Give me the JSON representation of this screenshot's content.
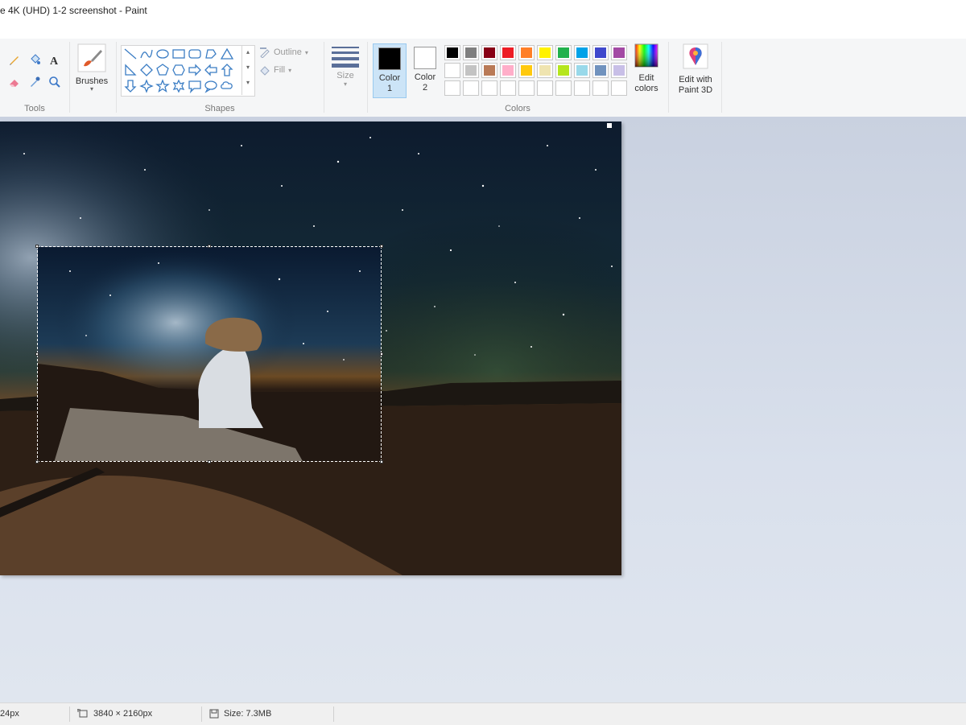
{
  "window": {
    "title": "e 4K (UHD) 1-2 screenshot - Paint"
  },
  "ribbon": {
    "tools": {
      "label": "Tools"
    },
    "brushes": {
      "label": "Brushes"
    },
    "shapes": {
      "label": "Shapes",
      "outline_label": "Outline",
      "fill_label": "Fill"
    },
    "size": {
      "label": "Size"
    },
    "color1": {
      "line1": "Color",
      "line2": "1",
      "value": "#000000"
    },
    "color2": {
      "line1": "Color",
      "line2": "2",
      "value": "#ffffff"
    },
    "colors": {
      "label": "Colors",
      "row1": [
        "#000000",
        "#7f7f7f",
        "#880015",
        "#ed1c24",
        "#ff7f27",
        "#fff200",
        "#22b14c",
        "#00a2e8",
        "#3f48cc",
        "#a349a4"
      ],
      "row2": [
        "#ffffff",
        "#c3c3c3",
        "#b97a57",
        "#ffaec9",
        "#ffc90e",
        "#efe4b0",
        "#b5e61d",
        "#99d9ea",
        "#7092be",
        "#c8bfe7"
      ]
    },
    "edit_colors": {
      "line1": "Edit",
      "line2": "colors"
    },
    "paint3d": {
      "line1": "Edit with",
      "line2": "Paint 3D"
    }
  },
  "status": {
    "cursor_pos": "24px",
    "dimensions": "3840 × 2160px",
    "file_size": "Size: 7.3MB"
  }
}
